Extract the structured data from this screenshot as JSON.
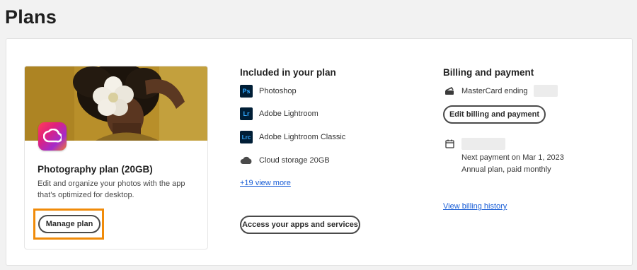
{
  "page": {
    "title": "Plans"
  },
  "plan": {
    "name": "Photography plan (20GB)",
    "description": "Edit and organize your photos with the app that's optimized for desktop.",
    "manage_label": "Manage plan"
  },
  "included": {
    "title": "Included in your plan",
    "apps": [
      {
        "icon_text": "Ps",
        "label": "Photoshop",
        "icon": "photoshop-icon"
      },
      {
        "icon_text": "Lr",
        "label": "Adobe Lightroom",
        "icon": "lightroom-icon"
      },
      {
        "icon_text": "Lrc",
        "label": "Adobe Lightroom Classic",
        "icon": "lightroom-classic-icon"
      },
      {
        "icon_text": "",
        "label": "Cloud storage 20GB",
        "icon": "cloud-icon"
      }
    ],
    "view_more": "+19 view more",
    "access_label": "Access your apps and services"
  },
  "billing": {
    "title": "Billing and payment",
    "card_text": "MasterCard ending",
    "edit_label": "Edit billing and payment",
    "next_payment": "Next payment on Mar 1, 2023",
    "plan_type": "Annual plan, paid monthly",
    "history_link": "View billing history"
  },
  "colors": {
    "highlight": "#f08b0a",
    "link": "#1a5ed6",
    "ps_bg": "#001e36",
    "ps_fg": "#31a8ff",
    "lr_bg": "#001e36",
    "lr_fg": "#31a8ff"
  }
}
